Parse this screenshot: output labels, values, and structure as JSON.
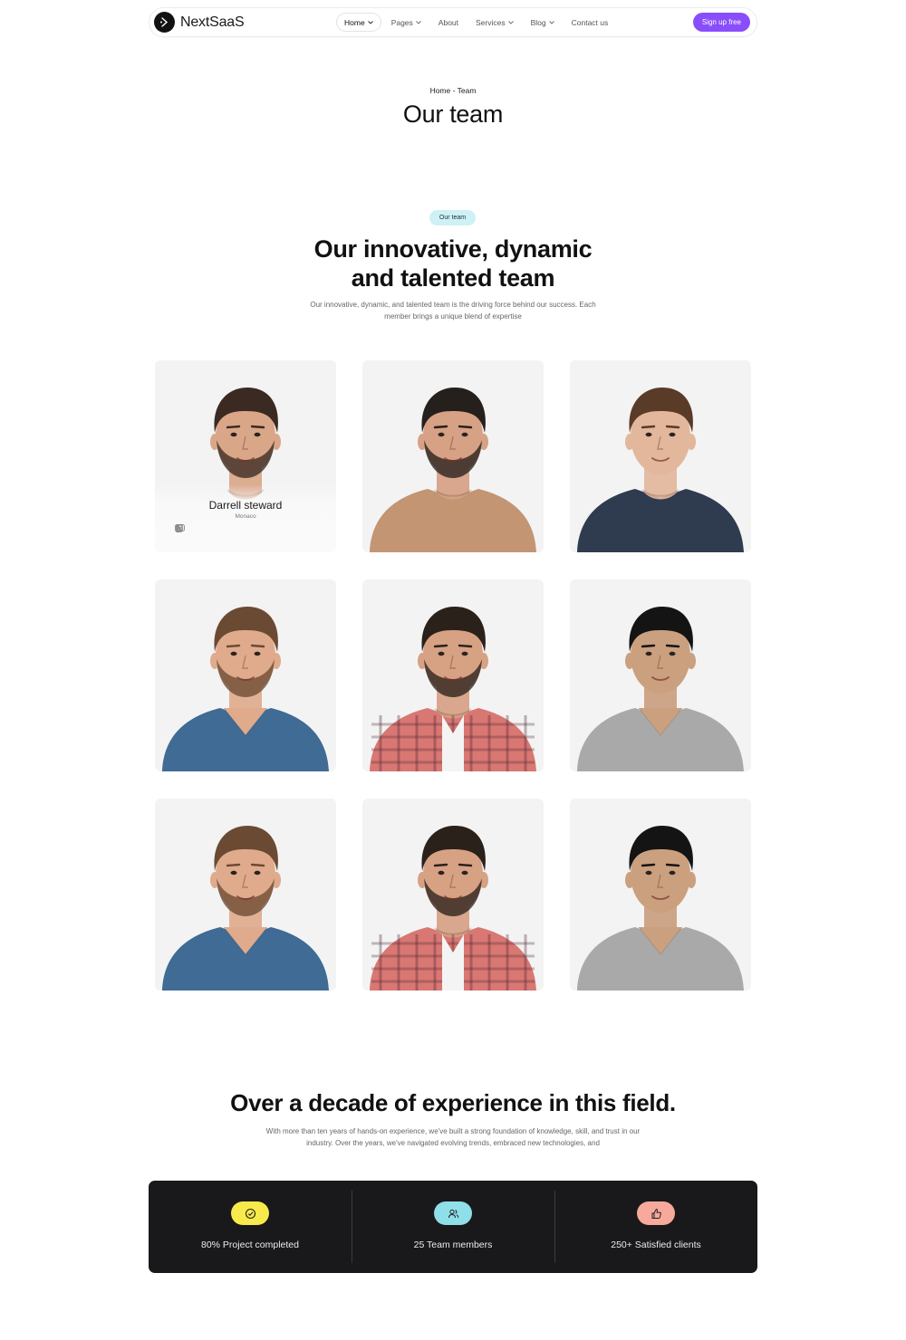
{
  "nav": {
    "brand": "NextSaaS",
    "links": [
      {
        "label": "Home",
        "dropdown": true,
        "active": true
      },
      {
        "label": "Pages",
        "dropdown": true,
        "active": false
      },
      {
        "label": "About",
        "dropdown": false,
        "active": false
      },
      {
        "label": "Services",
        "dropdown": true,
        "active": false
      },
      {
        "label": "Blog",
        "dropdown": true,
        "active": false
      },
      {
        "label": "Contact us",
        "dropdown": false,
        "active": false
      }
    ],
    "cta": "Sign up free",
    "accent": "#8a4dfb"
  },
  "hero": {
    "breadcrumb": "Home - Team",
    "title": "Our team"
  },
  "team_section": {
    "badge": "Our team",
    "title_line1": "Our innovative, dynamic",
    "title_line2": "and talented team",
    "description": "Our innovative, dynamic, and talented team is the driving force behind our success. Each member brings a unique blend of expertise",
    "featured_member": {
      "name": "Darrell steward",
      "location": "Monaco",
      "socials": [
        "facebook-icon",
        "instagram-icon",
        "youtube-icon",
        "linkedin-icon",
        "dribbble-icon",
        "behance-icon"
      ]
    },
    "members": [
      {
        "photo": "portrait-man-white-tshirt",
        "shirt": "#f2f2f2",
        "hair": "#3a2a22",
        "skin": "#d9a788",
        "beard": true
      },
      {
        "photo": "portrait-man-brown-tshirt",
        "shirt": "#c39573",
        "hair": "#26201c",
        "skin": "#d6a184",
        "beard": true
      },
      {
        "photo": "portrait-man-navy-henley",
        "shirt": "#2f3b4f",
        "hair": "#5a3b27",
        "skin": "#e3b79c",
        "beard": false
      },
      {
        "photo": "portrait-man-blue-vneck",
        "shirt": "#3f6b94",
        "hair": "#6b4a33",
        "skin": "#e0ab8c",
        "beard": true
      },
      {
        "photo": "portrait-man-plaid-shirt",
        "shirt": "#d97773",
        "hair": "#2b211b",
        "skin": "#d7a184",
        "beard": true
      },
      {
        "photo": "portrait-man-grey-vneck",
        "shirt": "#a9a9a9",
        "hair": "#141414",
        "skin": "#caa07f",
        "beard": false
      },
      {
        "photo": "portrait-man-blue-vneck",
        "shirt": "#3f6b94",
        "hair": "#6b4a33",
        "skin": "#e0ab8c",
        "beard": true
      },
      {
        "photo": "portrait-man-plaid-shirt",
        "shirt": "#d97773",
        "hair": "#2b211b",
        "skin": "#d7a184",
        "beard": true
      },
      {
        "photo": "portrait-man-grey-vneck",
        "shirt": "#a9a9a9",
        "hair": "#141414",
        "skin": "#caa07f",
        "beard": false
      }
    ]
  },
  "experience": {
    "title": "Over a decade of experience in this field.",
    "description": "With more than ten years of hands-on experience, we've built a strong foundation of knowledge, skill, and trust in our industry. Over the years, we've navigated evolving trends, embraced new technologies, and"
  },
  "stats": [
    {
      "label": "80% Project completed",
      "icon": "check-circle-icon",
      "color": "#f7ea4a"
    },
    {
      "label": "25 Team members",
      "icon": "users-icon",
      "color": "#8fdfe8"
    },
    {
      "label": "250+ Satisfied clients",
      "icon": "thumbs-up-icon",
      "color": "#f7a99c"
    }
  ]
}
